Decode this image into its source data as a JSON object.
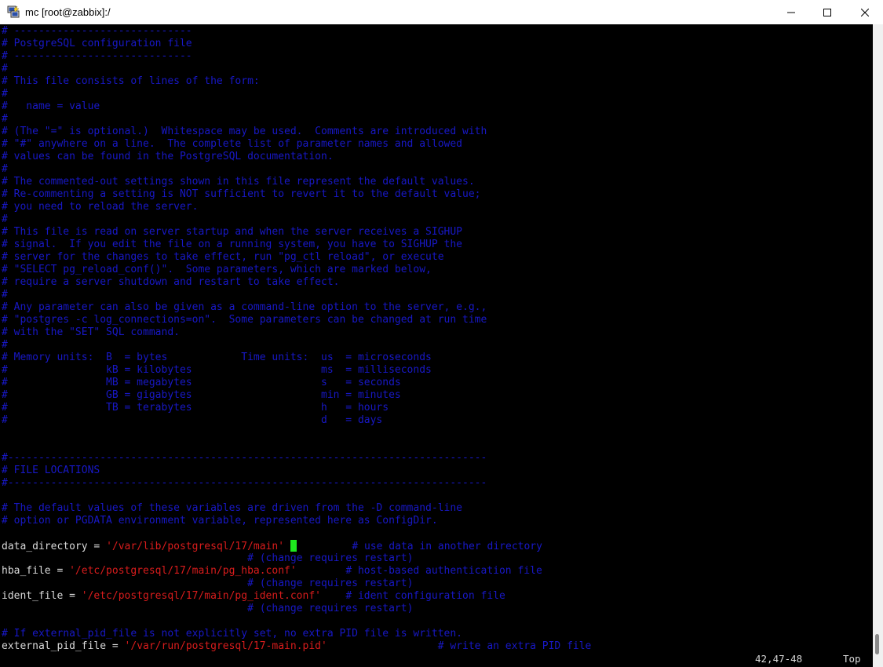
{
  "window": {
    "title": "mc [root@zabbix]:/",
    "icon": "putty-icon",
    "controls": [
      "minimize-icon",
      "maximize-icon",
      "close-icon"
    ]
  },
  "colors": {
    "comment": "#1818c6",
    "keyword": "#d9d9d9",
    "string": "#d81c1c",
    "cursor": "#1ee81e",
    "background": "#000000"
  },
  "terminal": {
    "lines": [
      "# -----------------------------",
      "# PostgreSQL configuration file",
      "# -----------------------------",
      "#",
      "# This file consists of lines of the form:",
      "#",
      "#   name = value",
      "#",
      "# (The \"=\" is optional.)  Whitespace may be used.  Comments are introduced with",
      "# \"#\" anywhere on a line.  The complete list of parameter names and allowed",
      "# values can be found in the PostgreSQL documentation.",
      "#",
      "# The commented-out settings shown in this file represent the default values.",
      "# Re-commenting a setting is NOT sufficient to revert it to the default value;",
      "# you need to reload the server.",
      "#",
      "# This file is read on server startup and when the server receives a SIGHUP",
      "# signal.  If you edit the file on a running system, you have to SIGHUP the",
      "# server for the changes to take effect, run \"pg_ctl reload\", or execute",
      "# \"SELECT pg_reload_conf()\".  Some parameters, which are marked below,",
      "# require a server shutdown and restart to take effect.",
      "#",
      "# Any parameter can also be given as a command-line option to the server, e.g.,",
      "# \"postgres -c log_connections=on\".  Some parameters can be changed at run time",
      "# with the \"SET\" SQL command.",
      "#",
      "# Memory units:  B  = bytes            Time units:  us  = microseconds",
      "#                kB = kilobytes                     ms  = milliseconds",
      "#                MB = megabytes                     s   = seconds",
      "#                GB = gigabytes                     min = minutes",
      "#                TB = terabytes                     h   = hours",
      "#                                                   d   = days",
      "",
      "",
      "#------------------------------------------------------------------------------",
      "# FILE LOCATIONS",
      "#------------------------------------------------------------------------------",
      "",
      "# The default values of these variables are driven from the -D command-line",
      "# option or PGDATA environment variable, represented here as ConfigDir.",
      ""
    ],
    "config": {
      "data_directory": {
        "key": "data_directory = ",
        "value": "'/var/lib/postgresql/17/main'",
        "gap": "         ",
        "comment": "# use data in another directory",
        "note_indent": "                                        ",
        "note": "# (change requires restart)"
      },
      "hba_file": {
        "key": "hba_file = ",
        "value": "'/etc/postgresql/17/main/pg_hba.conf'",
        "gap": "        ",
        "comment": "# host-based authentication file",
        "note_indent": "                                        ",
        "note": "# (change requires restart)"
      },
      "ident_file": {
        "key": "ident_file = ",
        "value": "'/etc/postgresql/17/main/pg_ident.conf'",
        "gap": "    ",
        "comment": "# ident configuration file",
        "note_indent": "                                        ",
        "note": "# (change requires restart)"
      },
      "pid_comment": "# If external_pid_file is not explicitly set, no extra PID file is written.",
      "external_pid_file": {
        "key": "external_pid_file = ",
        "value": "'/var/run/postgresql/17-main.pid'",
        "gap": "                  ",
        "comment": "# write an extra PID file"
      }
    },
    "status": {
      "position": "42,47-48",
      "scroll": "Top"
    }
  }
}
